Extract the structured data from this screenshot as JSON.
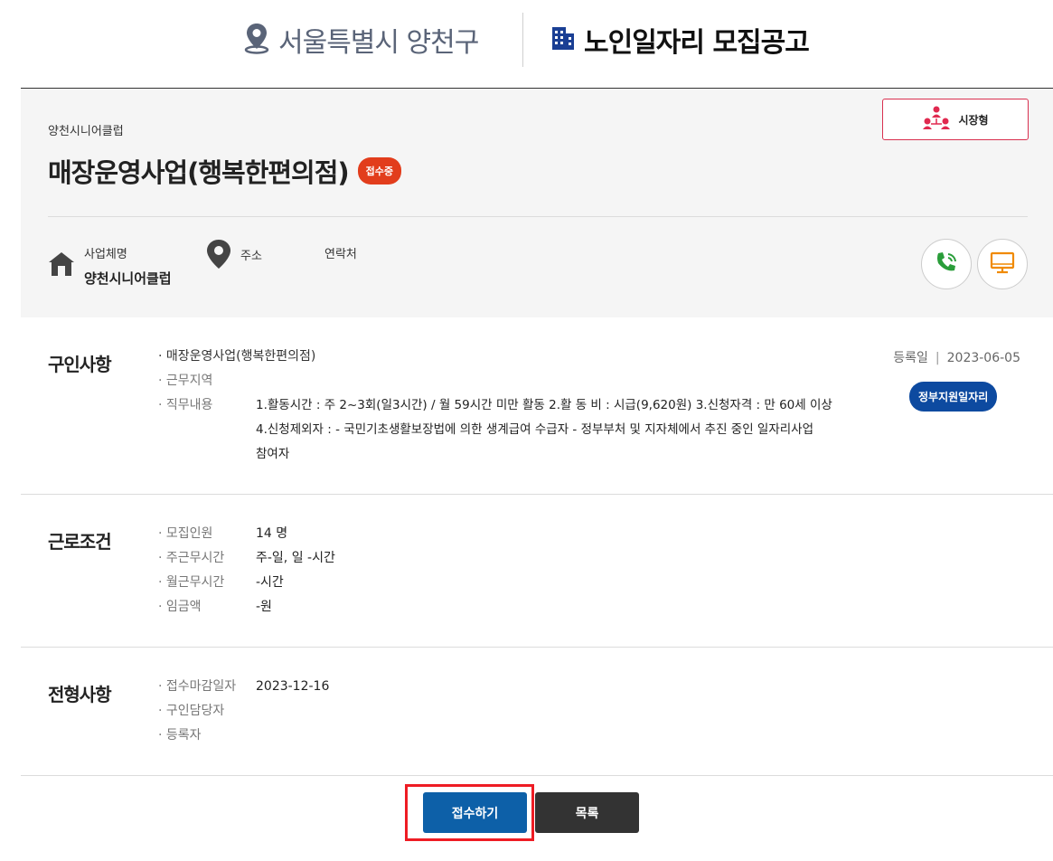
{
  "header": {
    "region": "서울특별시 양천구",
    "title": "노인일자리 모집공고"
  },
  "summary": {
    "org_small": "양천시니어클럽",
    "title": "매장운영사업(행복한편의점)",
    "status_badge": "접수중",
    "type_button": "시장형",
    "business_label": "사업체명",
    "business_value": "양천시니어클럽",
    "address_label": "주소",
    "address_value": "",
    "contact_label": "연락처",
    "contact_value": ""
  },
  "recruit": {
    "title": "구인사항",
    "item_name": "· 매장운영사업(행복한편의점)",
    "area_label": "· 근무지역",
    "duty_label": "· 직무내용",
    "duty_line1": "1.활동시간 : 주 2~3회(일3시간) / 월 59시간 미만 활동   2.활 동 비 : 시급(9,620원)   3.신청자격 : 만 60세 이상",
    "duty_line2": "4.신청제외자 :   - 국민기초생활보장법에 의한 생계급여 수급자   - 정부부처 및 지자체에서 추진 중인 일자리사업",
    "duty_line3": "참여자",
    "reg_label": "등록일",
    "reg_sep": "|",
    "reg_date": "2023-06-05",
    "gov_badge": "정부지원일자리"
  },
  "conditions": {
    "title": "근로조건",
    "rows": [
      {
        "label": "· 모집인원",
        "value": "14 명"
      },
      {
        "label": "· 주근무시간",
        "value": "주-일, 일 -시간"
      },
      {
        "label": "· 월근무시간",
        "value": "-시간"
      },
      {
        "label": "· 임금액",
        "value": "-원"
      }
    ]
  },
  "screening": {
    "title": "전형사항",
    "rows": [
      {
        "label": "· 접수마감일자",
        "value": "2023-12-16"
      },
      {
        "label": "· 구인담당자",
        "value": ""
      },
      {
        "label": "· 등록자",
        "value": ""
      }
    ]
  },
  "actions": {
    "apply": "접수하기",
    "list": "목록"
  },
  "colors": {
    "primary": "#0d60a8",
    "badge_red": "#e23d1c",
    "gov_blue": "#0d4aa0",
    "highlight": "#ee1c24"
  }
}
